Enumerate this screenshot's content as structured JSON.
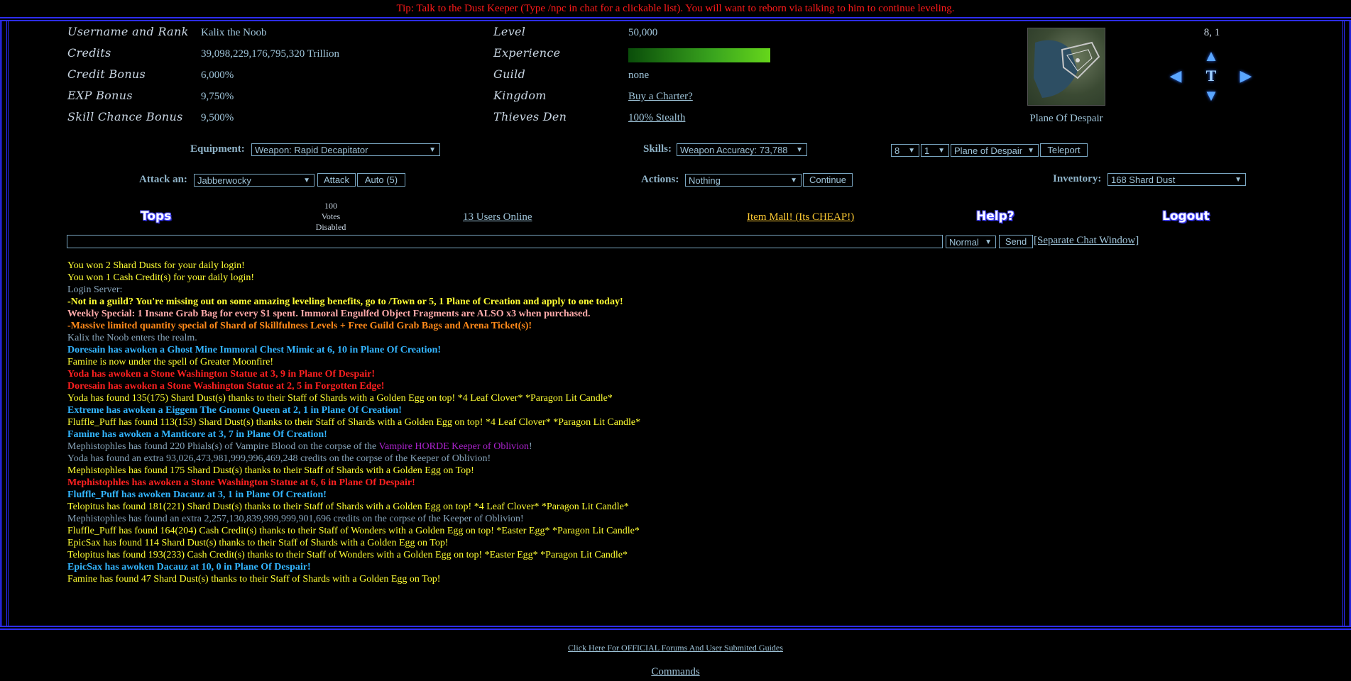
{
  "tip": "Tip: Talk to the Dust Keeper (Type /npc in chat for a clickable list). You will want to reborn via talking to him to continue leveling.",
  "stats_left": [
    {
      "label": "Username and Rank",
      "value": "Kalix the Noob"
    },
    {
      "label": "Credits",
      "value": "39,098,229,176,795,320 Trillion"
    },
    {
      "label": "Credit Bonus",
      "value": "6,000%"
    },
    {
      "label": "EXP Bonus",
      "value": "9,750%"
    },
    {
      "label": "Skill Chance Bonus",
      "value": "9,500%"
    }
  ],
  "stats_right": {
    "level_label": "Level",
    "level": "50,000",
    "experience_label": "Experience",
    "experience_fraction": 1.0,
    "guild_label": "Guild",
    "guild": "none",
    "kingdom_label": "Kingdom",
    "kingdom_link": "Buy a Charter?",
    "thieves_label": "Thieves Den",
    "thieves_link": "100% Stealth"
  },
  "map": {
    "location_name": "Plane Of Despair",
    "coords": "8, 1",
    "center_glyph": "T"
  },
  "equipment": {
    "label": "Equipment:",
    "selected": "Weapon: Rapid Decapitator"
  },
  "skills": {
    "label": "Skills:",
    "selected": "Weapon Accuracy: 73,788"
  },
  "teleport": {
    "x": "8",
    "y": "1",
    "plane": "Plane of Despair",
    "button": "Teleport"
  },
  "attack": {
    "label": "Attack an:",
    "selected": "Jabberwocky",
    "attack_button": "Attack",
    "auto_button": "Auto (5)"
  },
  "actions": {
    "label": "Actions:",
    "selected": "Nothing",
    "continue_button": "Continue"
  },
  "inventory": {
    "label": "Inventory:",
    "selected": "168 Shard Dust"
  },
  "nav": {
    "tops": "Tops",
    "votes_line1": "100",
    "votes_line2": "Votes",
    "votes_line3": "Disabled",
    "users_online": "13 Users Online",
    "item_mall": "Item Mall! (Its CHEAP!)",
    "help": "Help?",
    "logout": "Logout"
  },
  "chat": {
    "mode": "Normal",
    "send": "Send",
    "separate": "[Separate Chat Window]"
  },
  "log": [
    {
      "text": "You won 2 Shard Dusts for your daily login!",
      "cls": "yel"
    },
    {
      "text": "You won 1 Cash Credit(s) for your daily login!",
      "cls": "yel"
    },
    {
      "text": "Login Server:",
      "cls": "gr"
    },
    {
      "text": "-Not in a guild? You're missing out on some amazing leveling benefits, go to /Town or 5, 1 Plane of Creation and apply to one today!",
      "cls": "yel b"
    },
    {
      "text": "Weekly Special: 1 Insane Grab Bag for every $1 spent. Immoral Engulfed Object Fragments are ALSO x3 when purchased.",
      "cls": "pk b"
    },
    {
      "text": "-Massive limited quantity special of Shard of Skillfulness Levels + Free Guild Grab Bags and Arena Ticket(s)!",
      "cls": "or b"
    },
    {
      "text": "Kalix the Noob enters the realm.",
      "cls": "gr"
    },
    {
      "text": "Doresain has awoken a Ghost Mine Immoral Chest Mimic at 6, 10 in Plane Of Creation!",
      "cls": "cy b"
    },
    {
      "text": "Famine is now under the spell of Greater Moonfire!",
      "cls": "yel"
    },
    {
      "text": "Yoda has awoken a Stone Washington Statue at 3, 9 in Plane Of Despair!",
      "cls": "red b"
    },
    {
      "text": "Doresain has awoken a Stone Washington Statue at 2, 5 in Forgotten Edge!",
      "cls": "red b"
    },
    {
      "text": "Yoda has found 135(175) Shard Dust(s) thanks to their Staff of Shards with a Golden Egg on top! *4 Leaf Clover* *Paragon Lit Candle*",
      "cls": "yel"
    },
    {
      "text": "Extreme has awoken a Eiggem The Gnome Queen at 2, 1 in Plane Of Creation!",
      "cls": "cy b"
    },
    {
      "text": "Fluffle_Puff has found 113(153) Shard Dust(s) thanks to their Staff of Shards with a Golden Egg on top! *4 Leaf Clover* *Paragon Lit Candle*",
      "cls": "yel"
    },
    {
      "text": "Famine has awoken a Manticore at 3, 7 in Plane Of Creation!",
      "cls": "cy b"
    },
    {
      "pre": "Mephistophles has found 220 Phials(s) of Vampire Blood on the corpse of the ",
      "mid": "Vampire HORDE Keeper of Oblivion",
      "post": "!",
      "cls": "gr",
      "special": true
    },
    {
      "text": "Yoda has found an extra 93,026,473,981,999,996,469,248 credits on the corpse of the Keeper of Oblivion!",
      "cls": "gr"
    },
    {
      "text": "Mephistophles has found 175 Shard Dust(s) thanks to their Staff of Shards with a Golden Egg on Top!",
      "cls": "yel"
    },
    {
      "text": "Mephistophles has awoken a Stone Washington Statue at 6, 6 in Plane Of Despair!",
      "cls": "red b"
    },
    {
      "text": "Fluffle_Puff has awoken Dacauz at 3, 1 in Plane Of Creation!",
      "cls": "cy b"
    },
    {
      "text": "Telopitus has found 181(221) Shard Dust(s) thanks to their Staff of Shards with a Golden Egg on top! *4 Leaf Clover* *Paragon Lit Candle*",
      "cls": "yel"
    },
    {
      "text": "Mephistophles has found an extra 2,257,130,839,999,999,901,696 credits on the corpse of the Keeper of Oblivion!",
      "cls": "gr"
    },
    {
      "text": "Fluffle_Puff has found 164(204) Cash Credit(s) thanks to their Staff of Wonders with a Golden Egg on top! *Easter Egg* *Paragon Lit Candle*",
      "cls": "yel"
    },
    {
      "text": "EpicSax has found 114 Shard Dust(s) thanks to their Staff of Shards with a Golden Egg on Top!",
      "cls": "yel"
    },
    {
      "text": "Telopitus has found 193(233) Cash Credit(s) thanks to their Staff of Wonders with a Golden Egg on top! *Easter Egg* *Paragon Lit Candle*",
      "cls": "yel"
    },
    {
      "text": "EpicSax has awoken Dacauz at 10, 0 in Plane Of Despair!",
      "cls": "cy b"
    },
    {
      "text": "Famine has found 47 Shard Dust(s) thanks to their Staff of Shards with a Golden Egg on Top!",
      "cls": "yel"
    }
  ],
  "footer": {
    "forums": "Click Here For OFFICIAL Forums And User Submited Guides",
    "commands": "Commands"
  },
  "colors": {
    "frame": "#2d2dff",
    "tip": "#ff1a1a",
    "highlight": "#ffff33",
    "awoken": "#33b5ff",
    "danger": "#ff2020",
    "mall": "#ffcc33"
  }
}
